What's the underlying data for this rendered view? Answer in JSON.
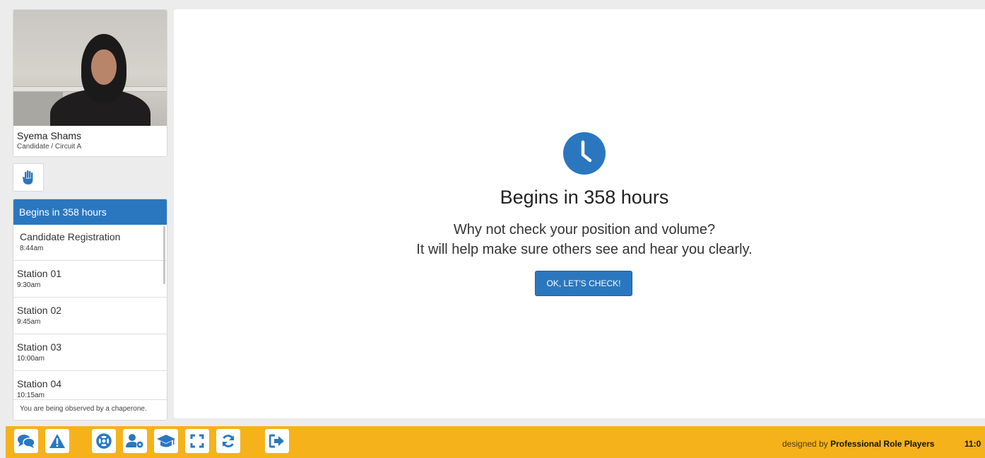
{
  "candidate": {
    "name": "Syema Shams",
    "role": "Candidate / Circuit A"
  },
  "schedule": {
    "header": "Begins in 358 hours",
    "items": [
      {
        "title": "Candidate Registration",
        "time": "8:44am"
      },
      {
        "title": "Station 01",
        "time": "9:30am"
      },
      {
        "title": "Station 02",
        "time": "9:45am"
      },
      {
        "title": "Station 03",
        "time": "10:00am"
      },
      {
        "title": "Station 04",
        "time": "10:15am"
      }
    ],
    "observed_note": "You are being observed by a chaperone."
  },
  "main": {
    "heading": "Begins in 358 hours",
    "message_line1": "Why not check your position and volume?",
    "message_line2": "It will help make sure others see and hear you clearly.",
    "button_label": "OK, LET'S CHECK!"
  },
  "toolbar": {
    "icons": [
      "chat-icon",
      "warning-icon",
      "lifebuoy-icon",
      "user-settings-icon",
      "graduation-cap-icon",
      "fullscreen-icon",
      "refresh-icon",
      "sign-out-icon"
    ],
    "credit_prefix": "designed by",
    "credit_brand": "Professional Role Players",
    "time": "11:0"
  },
  "colors": {
    "accent": "#2a77c0",
    "toolbar": "#f6b21a",
    "background": "#ececec"
  }
}
